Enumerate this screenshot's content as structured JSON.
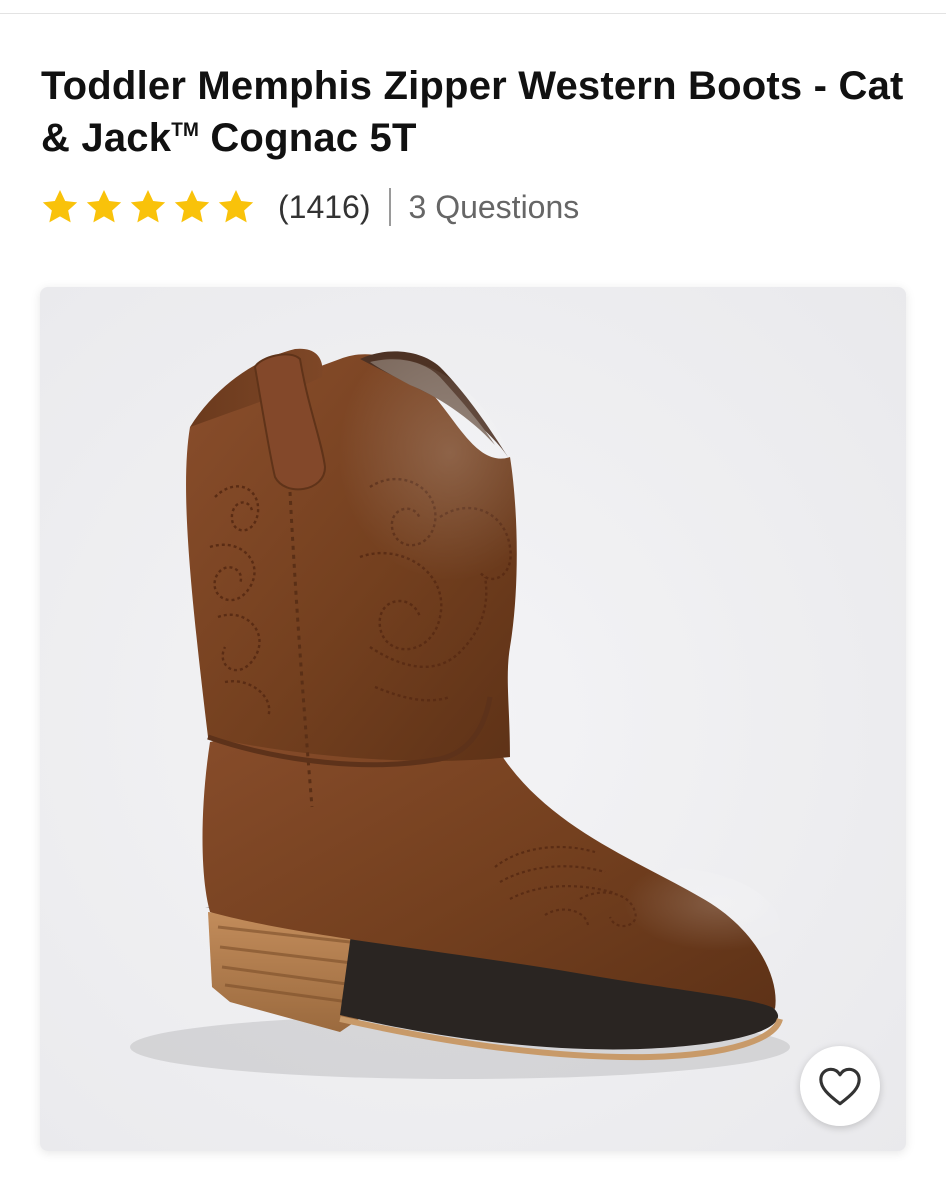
{
  "product": {
    "title_main": "Toddler Memphis Zipper Western Boots - Cat & Jack",
    "title_trademark": "TM",
    "title_variant": " Cognac 5T"
  },
  "rating": {
    "stars": 5,
    "max_stars": 5,
    "count_label": "(1416)",
    "star_color": "#F9C20A"
  },
  "questions": {
    "label": "3 Questions"
  },
  "image": {
    "alt": "Toddler Memphis Zipper Western Boots - Cat & Jack Cognac 5T",
    "leather_color": "#7A4326",
    "sole_color": "#B07A4B"
  },
  "favorite": {
    "icon": "heart-outline-icon",
    "aria_label": "Add to favorites"
  }
}
